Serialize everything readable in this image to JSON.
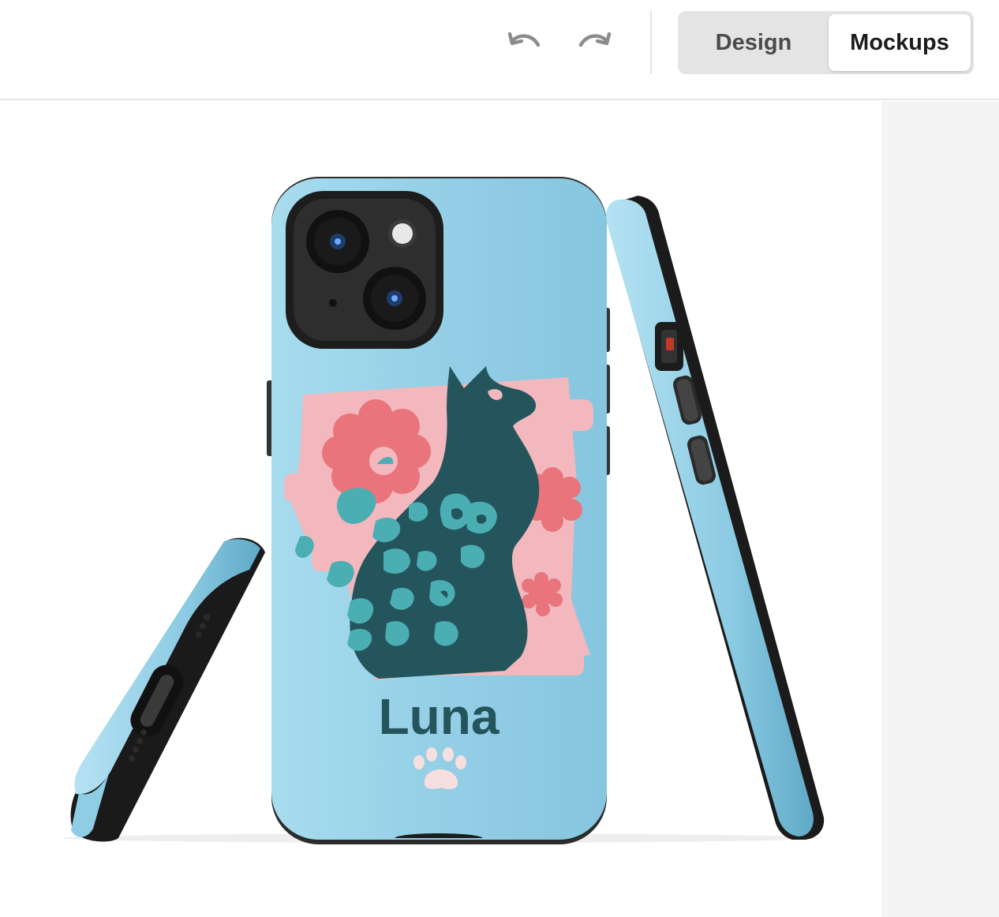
{
  "toolbar": {
    "undo_icon": "undo-icon",
    "redo_icon": "redo-icon",
    "tabs": [
      {
        "label": "Design",
        "active": false
      },
      {
        "label": "Mockups",
        "active": true
      }
    ]
  },
  "mockup": {
    "case_text": "Luna",
    "case_color": "#94cfe6",
    "accent_pink": "#f2b8bd",
    "flower_red": "#e9747c",
    "cat_color": "#25555c",
    "spot_color": "#4aaeb3",
    "icons": [
      "cat-illustration",
      "paw-icon",
      "flower-icon"
    ]
  }
}
